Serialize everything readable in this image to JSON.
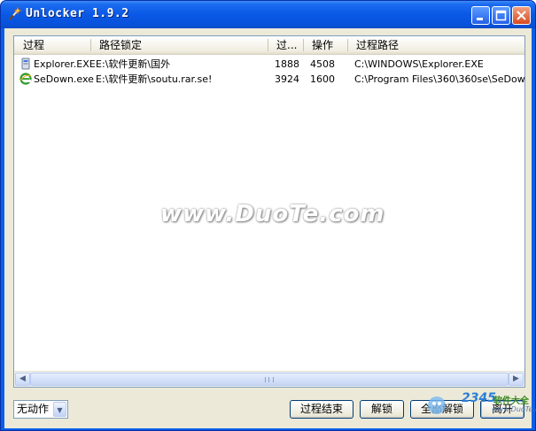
{
  "window": {
    "title": "Unlocker 1.9.2",
    "accent_color": "#0a5ee8",
    "icons": [
      "minimize-icon",
      "maximize-icon",
      "close-icon"
    ]
  },
  "list": {
    "columns": [
      {
        "label": "过程"
      },
      {
        "label": "路径锁定"
      },
      {
        "label": "过..."
      },
      {
        "label": "操作"
      },
      {
        "label": "过程路径"
      }
    ],
    "rows": [
      {
        "icon": "explorer-icon",
        "process": "Explorer.EXE",
        "locked_path": "E:\\软件更新\\国外",
        "pid": "1888",
        "handle": "4508",
        "process_path": "C:\\WINDOWS\\Explorer.EXE"
      },
      {
        "icon": "ie-icon",
        "process": "SeDown.exe",
        "locked_path": "E:\\软件更新\\soutu.rar.se!",
        "pid": "3924",
        "handle": "1600",
        "process_path": "C:\\Program Files\\360\\360se\\SeDow..."
      }
    ]
  },
  "watermark": "www.DuoTe.com",
  "action_select": {
    "value": "无动作"
  },
  "buttons": {
    "kill_process": "过程结束",
    "unlock": "解锁",
    "unlock_all": "全部解锁",
    "quit": "离开"
  },
  "badge": {
    "number": "2345",
    "name": "软件大全",
    "url": "www.DuoTe.com"
  }
}
